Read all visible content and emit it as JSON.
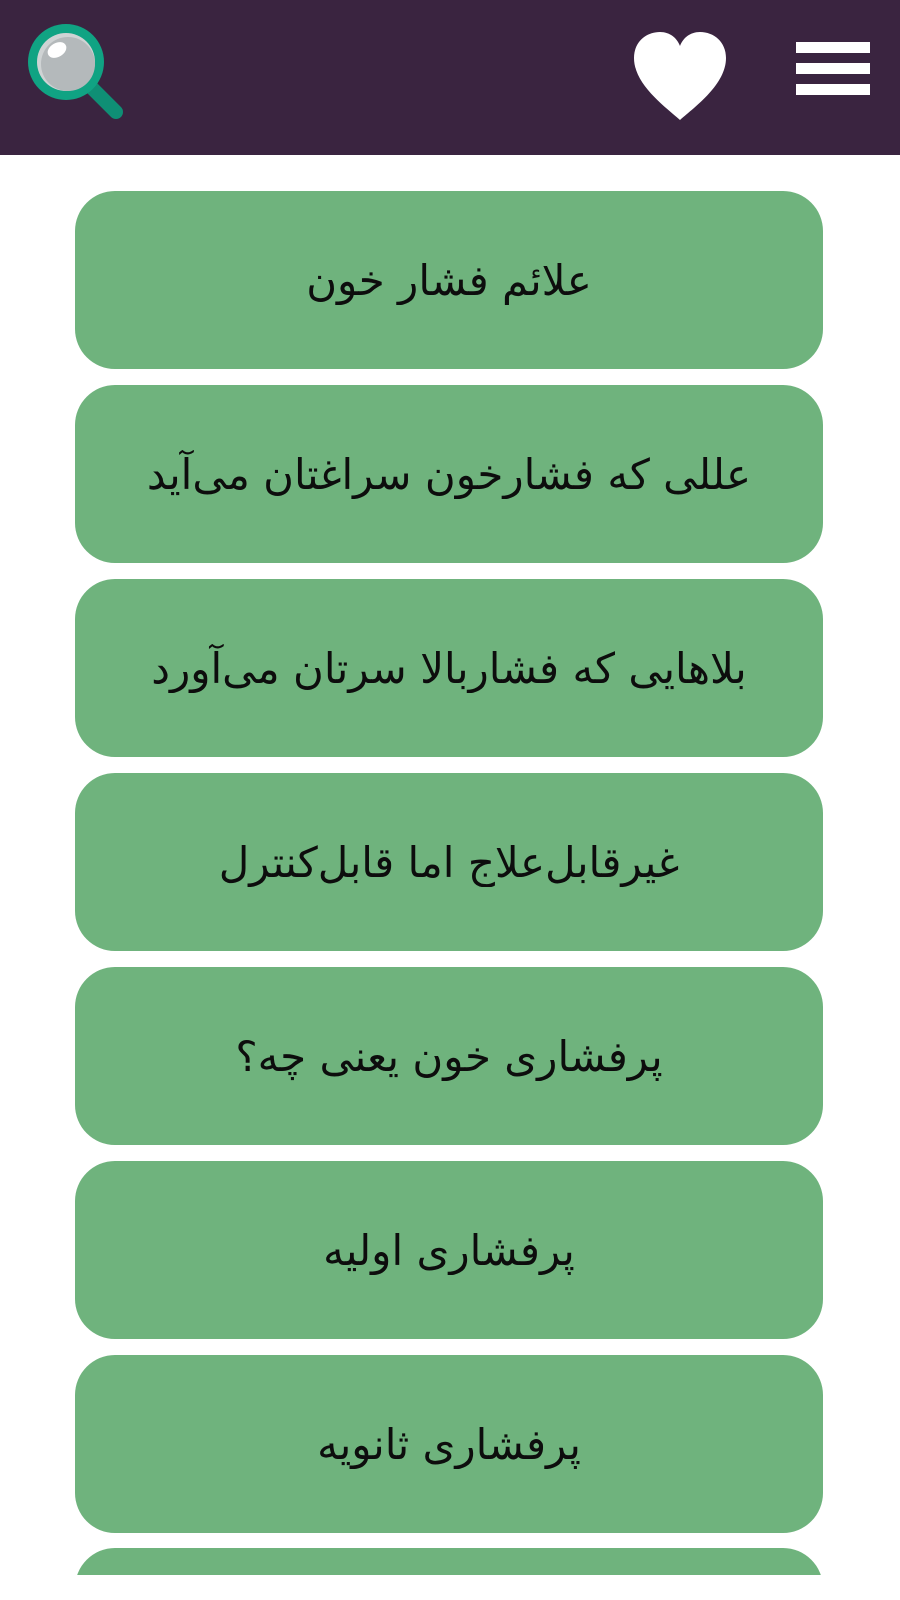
{
  "header": {
    "background_color": "#3a2440",
    "search_icon": "search-magnifier-icon",
    "favorite_icon": "heart-icon",
    "menu_icon": "hamburger-menu-icon"
  },
  "list": {
    "item_color": "#6fb37d",
    "items": [
      {
        "label": "علائم فشار خون"
      },
      {
        "label": "عللی که فشارخون سراغتان می‌آید"
      },
      {
        "label": "بلاهایی که فشاربالا سرتان می‌آورد"
      },
      {
        "label": "غیرقابل‌علاج اما قابل‌کنترل"
      },
      {
        "label": "پرفشاری خون یعنی چه؟"
      },
      {
        "label": "پرفشاری اولیه"
      },
      {
        "label": "پرفشاری ثانویه"
      }
    ]
  }
}
